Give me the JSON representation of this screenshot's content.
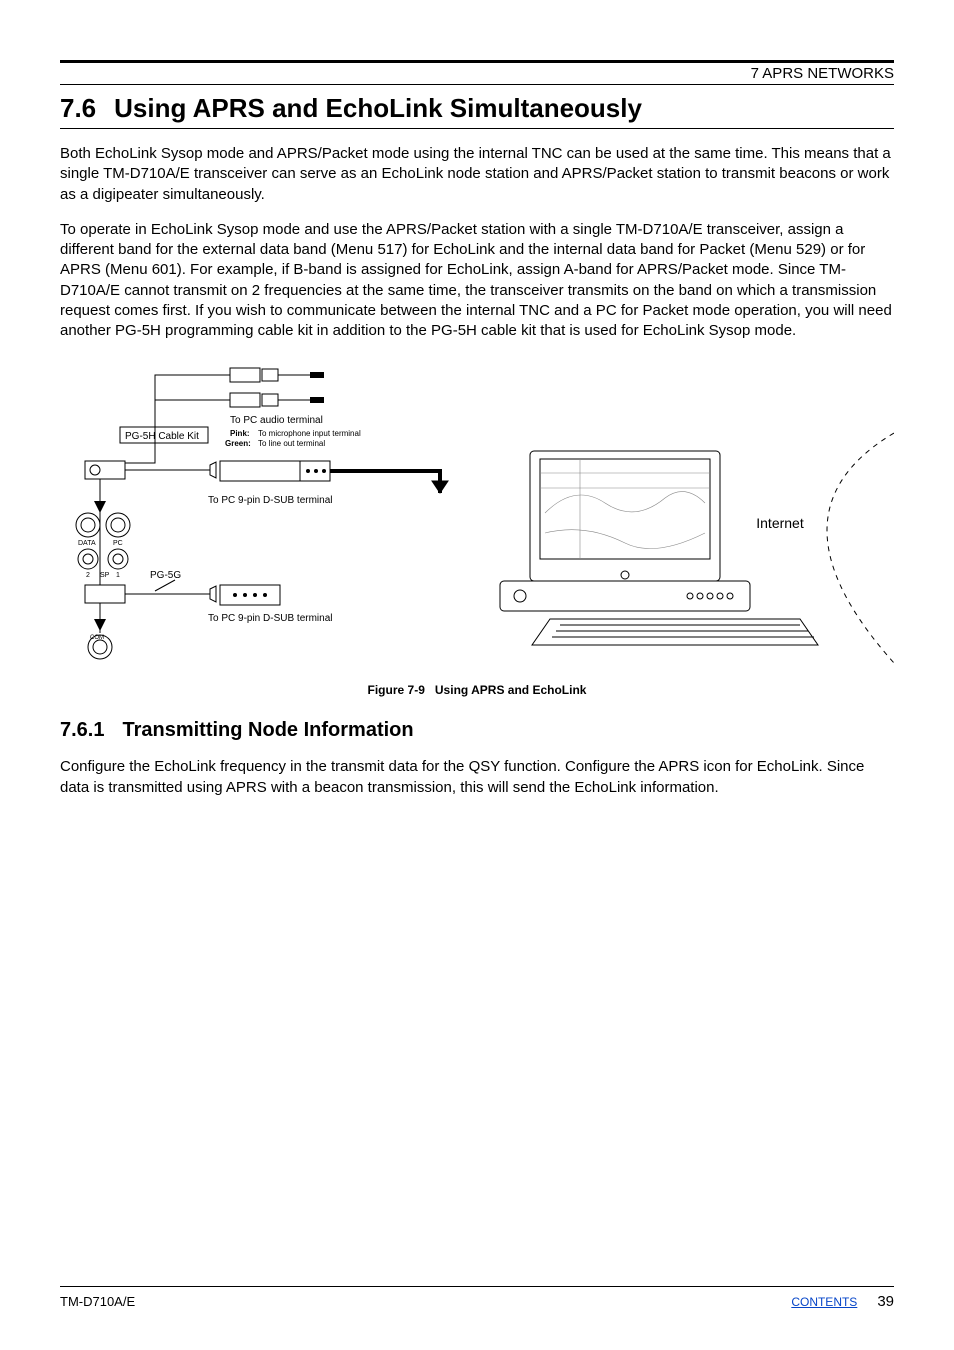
{
  "header": {
    "chapter": "7 APRS NETWORKS"
  },
  "section": {
    "number": "7.6",
    "title": "Using APRS and EchoLink Simultaneously",
    "paragraphs": [
      "Both EchoLink Sysop mode and APRS/Packet mode using the internal TNC can be used at the same time.  This means that a single TM-D710A/E transceiver can serve as an EchoLink node station and APRS/Packet station to transmit beacons or work as a digipeater simultaneously.",
      "To operate in EchoLink Sysop mode and use the APRS/Packet station with a single TM-D710A/E transceiver, assign a different band for the external data band (Menu 517) for EchoLink and the internal data band for Packet (Menu 529) or for APRS (Menu 601).  For example, if B-band is assigned for EchoLink, assign A-band for APRS/Packet mode.  Since TM-D710A/E cannot transmit on 2 frequencies at the same time, the transceiver transmits on the band on which a transmission request comes first.  If you wish to communicate between the internal TNC and a PC for Packet mode operation, you will need another PG-5H programming cable kit in addition to the PG-5H cable kit that is used for EchoLink Sysop mode."
    ]
  },
  "figure": {
    "caption_number": "Figure 7-9",
    "caption_title": "Using APRS and EchoLink",
    "labels": {
      "cable_kit": "PG-5H Cable Kit",
      "pc_audio": "To PC audio terminal",
      "pink": "Pink:",
      "pink_text": "To microphone input terminal",
      "green": "Green:",
      "green_text": "To line out terminal",
      "dsub_top": "To PC 9-pin D-SUB terminal",
      "pg5g": "PG-5G",
      "dsub_bottom": "To PC 9-pin D-SUB terminal",
      "internet": "Internet",
      "ports": {
        "data": "DATA",
        "pc": "PC",
        "sp2": "2",
        "sp": "SP",
        "sp1": "1",
        "com": "COM"
      }
    }
  },
  "subsection": {
    "number": "7.6.1",
    "title": "Transmitting Node Information",
    "paragraph": "Configure the EchoLink frequency in the transmit data for the QSY function.  Configure the APRS icon for EchoLink.  Since data is transmitted using APRS with a beacon transmission, this will send the EchoLink information."
  },
  "footer": {
    "model": "TM-D710A/E",
    "contents": "CONTENTS",
    "page": "39"
  }
}
